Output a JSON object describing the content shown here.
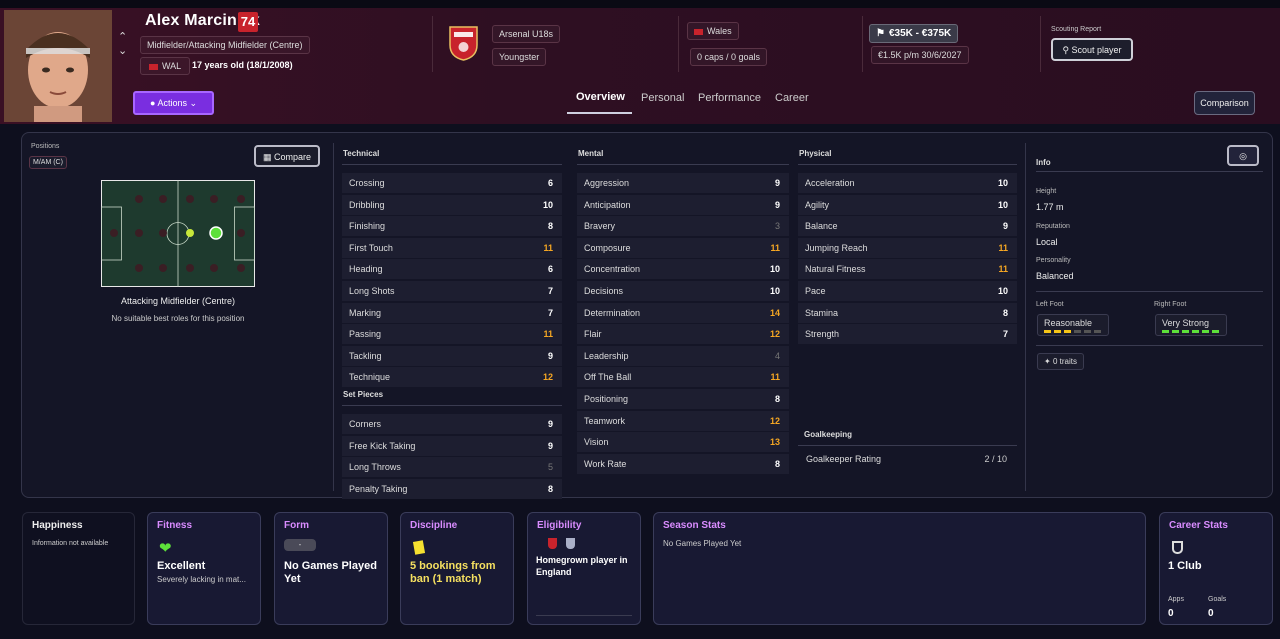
{
  "player": {
    "name": "Alex Marciniak",
    "rating": "74",
    "position_full": "Midfielder/Attacking Midfielder (Centre)",
    "nationality_code": "WAL",
    "age_text": "17 years old (18/1/2008)",
    "club": "Arsenal U18s",
    "squad_status": "Youngster",
    "nation": "Wales",
    "caps": "0 caps / 0 goals",
    "value": "€35K - €375K",
    "wage_contract": "€1.5K p/m  30/6/2027",
    "scouting_label": "Scouting Report",
    "scout_button": "Scout player",
    "actions_button": "Actions",
    "comparison_button": "Comparison"
  },
  "tabs": [
    "Overview",
    "Personal",
    "Performance",
    "Career"
  ],
  "positions": {
    "label": "Positions",
    "badge": "M/AM (C)",
    "compare_button": "Compare",
    "role_title": "Attacking Midfielder (Centre)",
    "role_note": "No suitable best roles for this position"
  },
  "technical": {
    "title": "Technical",
    "items": [
      {
        "name": "Crossing",
        "value": "6",
        "tone": "w"
      },
      {
        "name": "Dribbling",
        "value": "10",
        "tone": "w"
      },
      {
        "name": "Finishing",
        "value": "8",
        "tone": "w"
      },
      {
        "name": "First Touch",
        "value": "11",
        "tone": "o"
      },
      {
        "name": "Heading",
        "value": "6",
        "tone": "w"
      },
      {
        "name": "Long Shots",
        "value": "7",
        "tone": "w"
      },
      {
        "name": "Marking",
        "value": "7",
        "tone": "w"
      },
      {
        "name": "Passing",
        "value": "11",
        "tone": "o"
      },
      {
        "name": "Tackling",
        "value": "9",
        "tone": "w"
      },
      {
        "name": "Technique",
        "value": "12",
        "tone": "o"
      }
    ]
  },
  "set_pieces": {
    "title": "Set Pieces",
    "items": [
      {
        "name": "Corners",
        "value": "9",
        "tone": "w"
      },
      {
        "name": "Free Kick Taking",
        "value": "9",
        "tone": "w"
      },
      {
        "name": "Long Throws",
        "value": "5",
        "tone": "g"
      },
      {
        "name": "Penalty Taking",
        "value": "8",
        "tone": "w"
      }
    ]
  },
  "mental": {
    "title": "Mental",
    "items": [
      {
        "name": "Aggression",
        "value": "9",
        "tone": "w"
      },
      {
        "name": "Anticipation",
        "value": "9",
        "tone": "w"
      },
      {
        "name": "Bravery",
        "value": "3",
        "tone": "g"
      },
      {
        "name": "Composure",
        "value": "11",
        "tone": "o"
      },
      {
        "name": "Concentration",
        "value": "10",
        "tone": "w"
      },
      {
        "name": "Decisions",
        "value": "10",
        "tone": "w"
      },
      {
        "name": "Determination",
        "value": "14",
        "tone": "o"
      },
      {
        "name": "Flair",
        "value": "12",
        "tone": "o"
      },
      {
        "name": "Leadership",
        "value": "4",
        "tone": "g"
      },
      {
        "name": "Off The Ball",
        "value": "11",
        "tone": "o"
      },
      {
        "name": "Positioning",
        "value": "8",
        "tone": "w"
      },
      {
        "name": "Teamwork",
        "value": "12",
        "tone": "o"
      },
      {
        "name": "Vision",
        "value": "13",
        "tone": "o"
      },
      {
        "name": "Work Rate",
        "value": "8",
        "tone": "w"
      }
    ]
  },
  "physical": {
    "title": "Physical",
    "items": [
      {
        "name": "Acceleration",
        "value": "10",
        "tone": "w"
      },
      {
        "name": "Agility",
        "value": "10",
        "tone": "w"
      },
      {
        "name": "Balance",
        "value": "9",
        "tone": "w"
      },
      {
        "name": "Jumping Reach",
        "value": "11",
        "tone": "o"
      },
      {
        "name": "Natural Fitness",
        "value": "11",
        "tone": "o"
      },
      {
        "name": "Pace",
        "value": "10",
        "tone": "w"
      },
      {
        "name": "Stamina",
        "value": "8",
        "tone": "w"
      },
      {
        "name": "Strength",
        "value": "7",
        "tone": "w"
      }
    ]
  },
  "goalkeeping": {
    "title": "Goalkeeping",
    "label": "Goalkeeper Rating",
    "value": "2 / 10"
  },
  "info": {
    "title": "Info",
    "height_label": "Height",
    "height": "1.77 m",
    "reputation_label": "Reputation",
    "reputation": "Local",
    "personality_label": "Personality",
    "personality": "Balanced",
    "left_foot_label": "Left Foot",
    "left_foot": "Reasonable",
    "left_foot_level": 0.5,
    "right_foot_label": "Right Foot",
    "right_foot": "Very Strong",
    "right_foot_level": 1.0,
    "traits": "0 traits"
  },
  "cards": {
    "happiness": {
      "title": "Happiness",
      "text": "Information not available"
    },
    "fitness": {
      "title": "Fitness",
      "value": "Excellent",
      "note": "Severely lacking in mat..."
    },
    "form": {
      "title": "Form",
      "badge": "-",
      "value": "No Games Played Yet"
    },
    "discipline": {
      "title": "Discipline",
      "value": "5 bookings from ban (1 match)"
    },
    "eligibility": {
      "title": "Eligibility",
      "value": "Homegrown player in England"
    },
    "season": {
      "title": "Season Stats",
      "text": "No Games Played Yet"
    },
    "career": {
      "title": "Career Stats",
      "value": "1 Club",
      "apps_label": "Apps",
      "apps": "0",
      "goals_label": "Goals",
      "goals": "0"
    }
  },
  "colors": {
    "accent_purple": "#7a2ee0",
    "rating_red": "#c8232c",
    "orange_attr": "#f5a623",
    "green_foot": "#5de03a",
    "yellow_foot": "#f5c518"
  }
}
